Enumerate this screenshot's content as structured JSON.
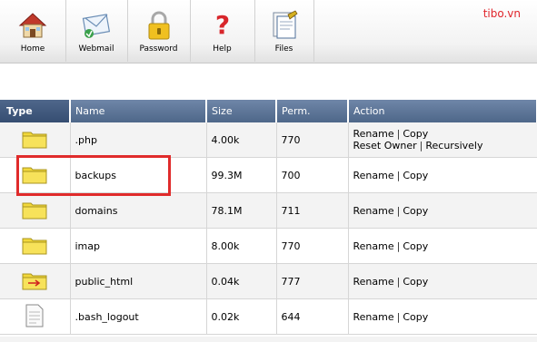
{
  "brand": "tibo.vn",
  "toolbar": [
    {
      "label": "Home",
      "icon": "home-icon"
    },
    {
      "label": "Webmail",
      "icon": "webmail-icon"
    },
    {
      "label": "Password",
      "icon": "lock-icon"
    },
    {
      "label": "Help",
      "icon": "help-icon"
    },
    {
      "label": "Files",
      "icon": "files-icon"
    }
  ],
  "table": {
    "headers": [
      "Type",
      "Name",
      "Size",
      "Perm.",
      "Action"
    ],
    "rows": [
      {
        "type": "folder",
        "name": ".php",
        "size": "4.00k",
        "perm": "770",
        "actions": [
          "Rename",
          "Copy"
        ],
        "actions2": [
          "Reset Owner",
          "Recursively"
        ]
      },
      {
        "type": "folder",
        "name": "backups",
        "size": "99.3M",
        "perm": "700",
        "actions": [
          "Rename",
          "Copy"
        ]
      },
      {
        "type": "folder",
        "name": "domains",
        "size": "78.1M",
        "perm": "711",
        "actions": [
          "Rename",
          "Copy"
        ]
      },
      {
        "type": "folder",
        "name": "imap",
        "size": "8.00k",
        "perm": "770",
        "actions": [
          "Rename",
          "Copy"
        ]
      },
      {
        "type": "folder-link",
        "name": "public_html",
        "size": "0.04k",
        "perm": "777",
        "actions": [
          "Rename",
          "Copy"
        ]
      },
      {
        "type": "file",
        "name": ".bash_logout",
        "size": "0.02k",
        "perm": "644",
        "actions": [
          "Rename",
          "Copy"
        ]
      }
    ]
  },
  "colors": {
    "header_bg": "#5a7396",
    "brand": "#e0252b",
    "highlight": "#e02b2b",
    "folder": "#f2d83a"
  }
}
